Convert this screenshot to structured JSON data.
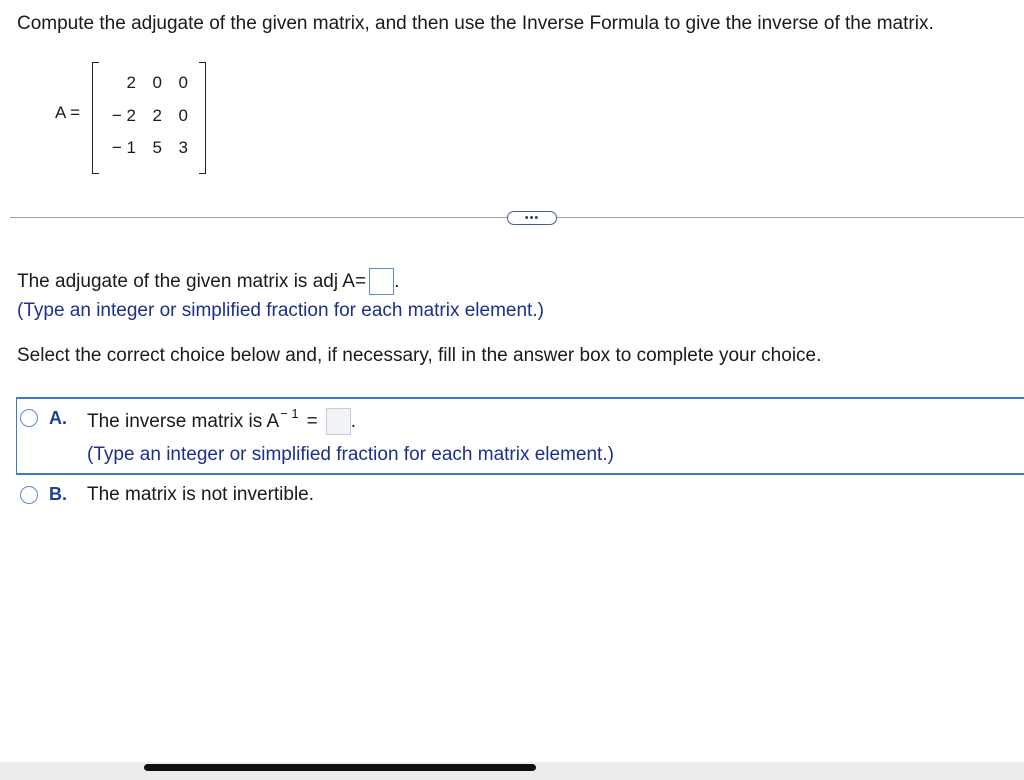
{
  "question": {
    "text": "Compute the adjugate of the given matrix, and then use the Inverse Formula to give the inverse of the matrix."
  },
  "matrix": {
    "label": "A =",
    "rows": [
      [
        "2",
        "0",
        "0"
      ],
      [
        "− 2",
        "2",
        "0"
      ],
      [
        "− 1",
        "5",
        "3"
      ]
    ]
  },
  "more_button": {
    "label": "•••"
  },
  "adjugate": {
    "prefix": "The adjugate of the given matrix is adj A=",
    "suffix": ".",
    "hint": "(Type an integer or simplified fraction for each matrix element.)"
  },
  "instruction": "Select the correct choice below and, if necessary, fill in the answer box to complete your choice.",
  "choices": {
    "a": {
      "letter": "A.",
      "text_prefix": "The inverse matrix is A",
      "exponent": "− 1",
      "equals": "=",
      "suffix": ".",
      "hint": "(Type an integer or simplified fraction for each matrix element.)"
    },
    "b": {
      "letter": "B.",
      "text": "The matrix is not invertible."
    }
  },
  "colors": {
    "accent": "#3d7cc6",
    "hint_text": "#1e2f8a",
    "answer_box_border": "#5b8bd0"
  }
}
